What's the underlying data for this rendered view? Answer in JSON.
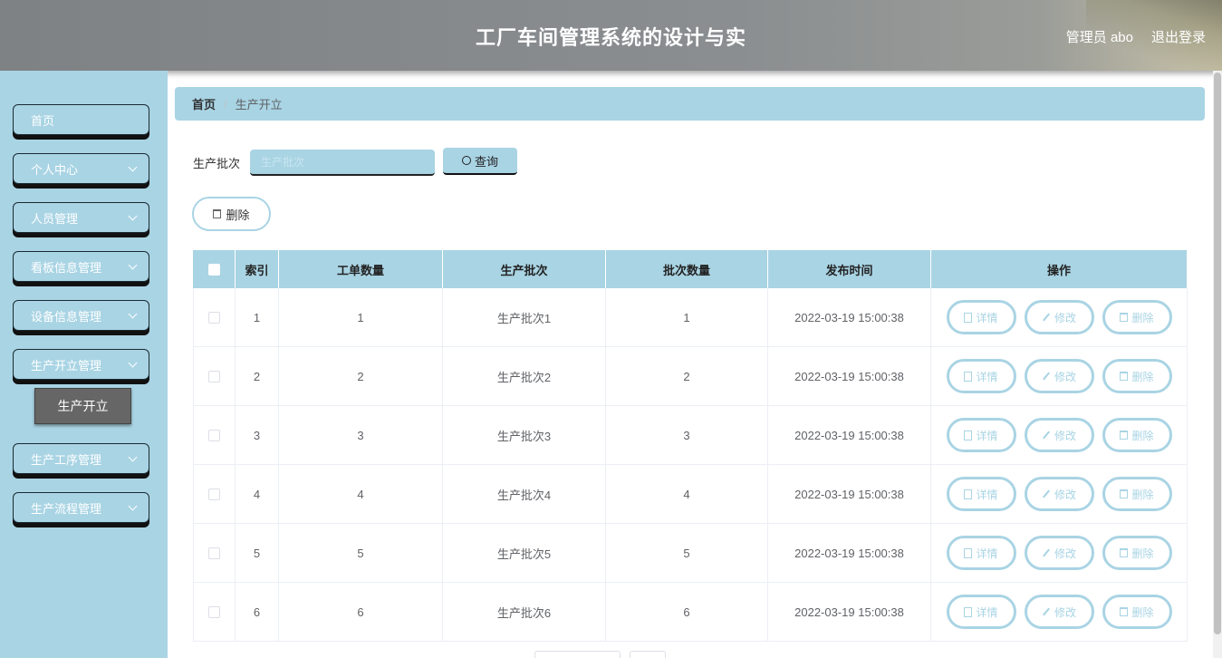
{
  "header": {
    "title": "工厂车间管理系统的设计与实",
    "user": "管理员 abo",
    "logout": "退出登录"
  },
  "sidebar": {
    "items": [
      {
        "label": "首页",
        "has_arrow": false
      },
      {
        "label": "个人中心",
        "has_arrow": true
      },
      {
        "label": "人员管理",
        "has_arrow": true
      },
      {
        "label": "看板信息管理",
        "has_arrow": true
      },
      {
        "label": "设备信息管理",
        "has_arrow": true
      },
      {
        "label": "生产开立管理",
        "has_arrow": true
      },
      {
        "label": "生产工序管理",
        "has_arrow": true
      },
      {
        "label": "生产流程管理",
        "has_arrow": true
      }
    ],
    "active_sub": "生产开立"
  },
  "breadcrumb": {
    "home": "首页",
    "separator": "/",
    "current": "生产开立"
  },
  "search": {
    "label": "生产批次",
    "placeholder": "生产批次",
    "button": "查询"
  },
  "actions": {
    "delete": "删除"
  },
  "table": {
    "columns": [
      "索引",
      "工单数量",
      "生产批次",
      "批次数量",
      "发布时间",
      "操作"
    ],
    "rows": [
      {
        "index": "1",
        "count": "1",
        "batch": "生产批次1",
        "batch_count": "1",
        "time": "2022-03-19 15:00:38"
      },
      {
        "index": "2",
        "count": "2",
        "batch": "生产批次2",
        "batch_count": "2",
        "time": "2022-03-19 15:00:38"
      },
      {
        "index": "3",
        "count": "3",
        "batch": "生产批次3",
        "batch_count": "3",
        "time": "2022-03-19 15:00:38"
      },
      {
        "index": "4",
        "count": "4",
        "batch": "生产批次4",
        "batch_count": "4",
        "time": "2022-03-19 15:00:38"
      },
      {
        "index": "5",
        "count": "5",
        "batch": "生产批次5",
        "batch_count": "5",
        "time": "2022-03-19 15:00:38"
      },
      {
        "index": "6",
        "count": "6",
        "batch": "生产批次6",
        "batch_count": "6",
        "time": "2022-03-19 15:00:38"
      }
    ],
    "ops": {
      "detail": "详情",
      "edit": "修改",
      "delete": "删除"
    }
  },
  "colors": {
    "accent": "#a9d4e4",
    "header": "#858a8c",
    "active_sub": "#666666"
  },
  "icons": [
    "search-icon",
    "trash-icon",
    "document-icon",
    "edit-icon",
    "chevron-down-icon"
  ]
}
